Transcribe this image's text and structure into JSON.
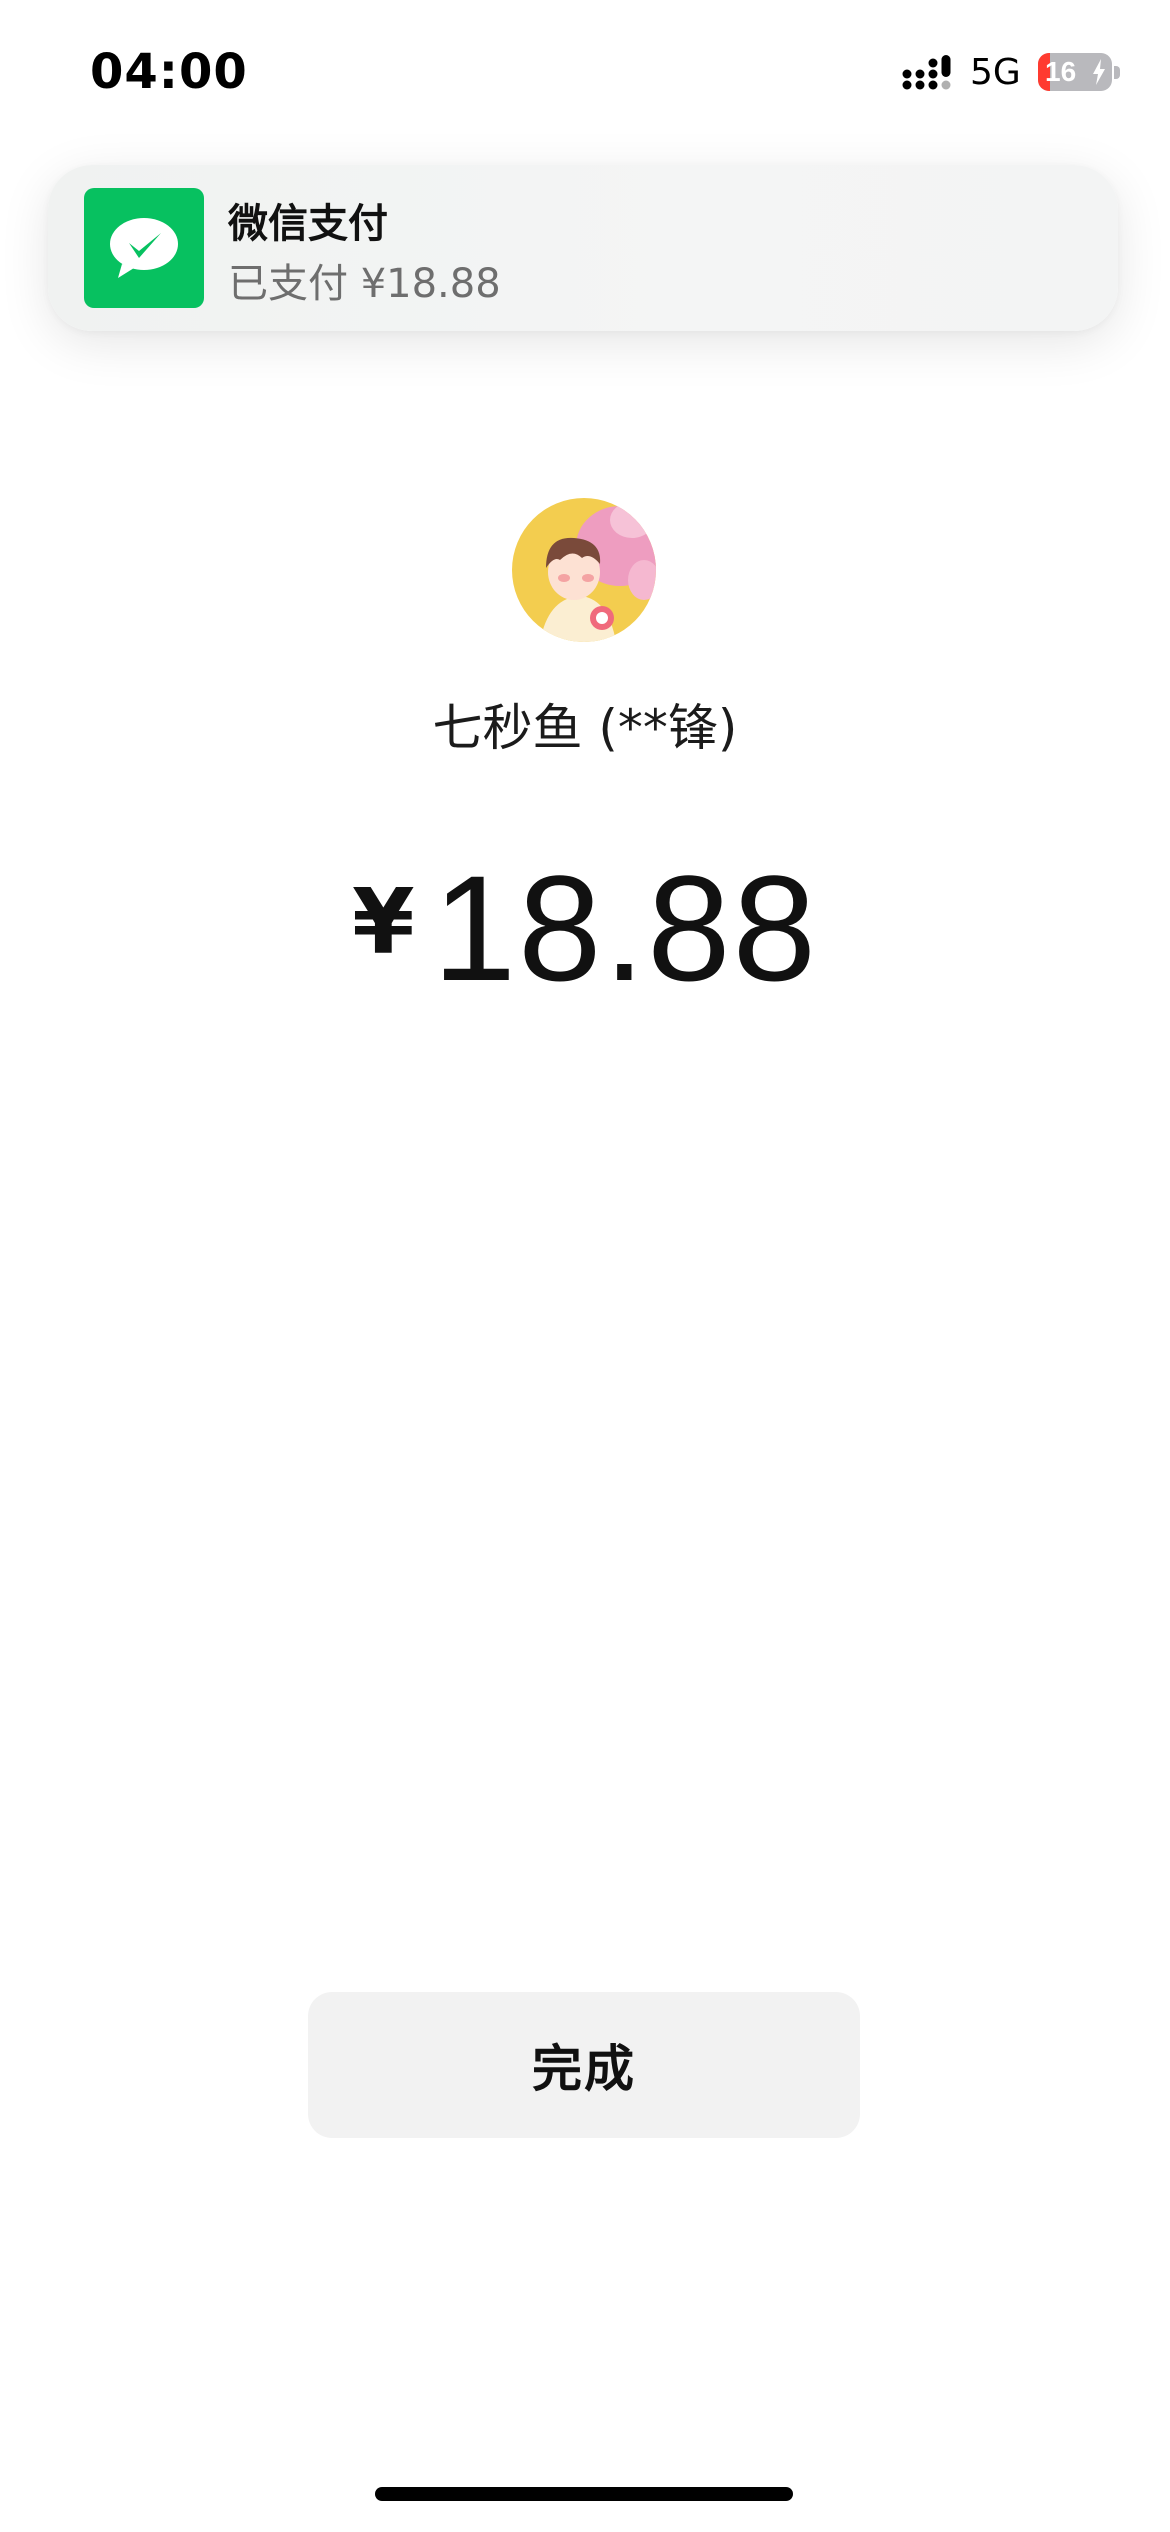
{
  "status_bar": {
    "time": "04:00",
    "network": "5G",
    "battery_level": "16",
    "battery_fraction": 0.16,
    "charging": true
  },
  "notification": {
    "app_name": "微信支付",
    "message": "已支付 ¥18.88",
    "icon": "wechat-pay-icon",
    "accent_color": "#07c160"
  },
  "payment": {
    "payee": "七秒鱼 (**锋)",
    "currency_symbol": "¥",
    "amount": "18.88"
  },
  "actions": {
    "done_label": "完成"
  }
}
